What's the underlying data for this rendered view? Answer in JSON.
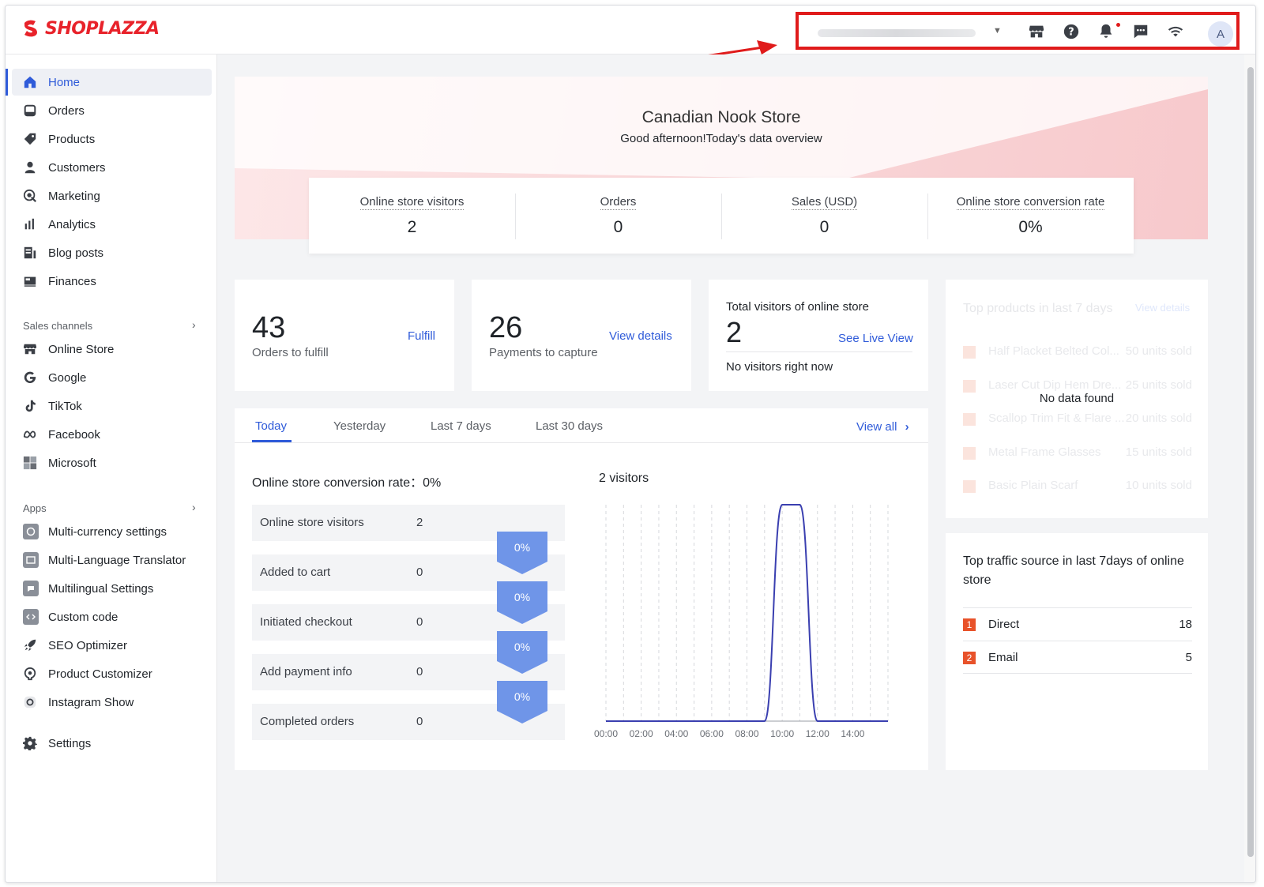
{
  "brand": {
    "name": "SHOPLAZZA",
    "color": "#e8222a"
  },
  "header": {
    "icons": [
      "store-icon",
      "help-icon",
      "bell-icon",
      "message-icon",
      "wifi-icon"
    ],
    "avatar_initial": "A"
  },
  "sidebar": {
    "main_items": [
      {
        "label": "Home",
        "icon": "home-icon",
        "active": true
      },
      {
        "label": "Orders",
        "icon": "orders-icon"
      },
      {
        "label": "Products",
        "icon": "tag-icon"
      },
      {
        "label": "Customers",
        "icon": "person-icon"
      },
      {
        "label": "Marketing",
        "icon": "marketing-icon"
      },
      {
        "label": "Analytics",
        "icon": "bar-chart-icon"
      },
      {
        "label": "Blog posts",
        "icon": "blog-icon"
      },
      {
        "label": "Finances",
        "icon": "finance-icon"
      }
    ],
    "sales_channels_label": "Sales channels",
    "channels": [
      {
        "label": "Online Store",
        "icon": "store-icon"
      },
      {
        "label": "Google",
        "icon": "google-icon"
      },
      {
        "label": "TikTok",
        "icon": "tiktok-icon"
      },
      {
        "label": "Facebook",
        "icon": "meta-icon"
      },
      {
        "label": "Microsoft",
        "icon": "microsoft-icon"
      }
    ],
    "apps_label": "Apps",
    "apps": [
      {
        "label": "Multi-currency settings",
        "icon": "currency-app-icon"
      },
      {
        "label": "Multi-Language Translator",
        "icon": "translator-app-icon"
      },
      {
        "label": "Multilingual Settings",
        "icon": "multilingual-app-icon"
      },
      {
        "label": "Custom code",
        "icon": "code-app-icon"
      },
      {
        "label": "SEO Optimizer",
        "icon": "rocket-icon"
      },
      {
        "label": "Product Customizer",
        "icon": "customizer-app-icon"
      },
      {
        "label": "Instagram Show",
        "icon": "instagram-icon"
      }
    ],
    "settings_label": "Settings"
  },
  "banner": {
    "store_name": "Canadian Nook Store",
    "greeting": "Good afternoon!Today's data overview"
  },
  "kpis": [
    {
      "label": "Online store visitors",
      "value": "2"
    },
    {
      "label": "Orders",
      "value": "0"
    },
    {
      "label": "Sales (USD)",
      "value": "0"
    },
    {
      "label": "Online store conversion rate",
      "value": "0%"
    }
  ],
  "fulfill_card": {
    "count": "43",
    "label": "Orders to fulfill",
    "action": "Fulfill"
  },
  "payments_card": {
    "count": "26",
    "label": "Payments to capture",
    "action": "View details"
  },
  "visitors_card": {
    "title": "Total visitors of online store",
    "count": "2",
    "action": "See Live View",
    "note": "No visitors right now"
  },
  "top_products": {
    "title": "Top products in last 7 days",
    "action": "View details",
    "empty": "No data found",
    "items": [
      {
        "rank": "1",
        "name": "Half Placket Belted Col...",
        "sold": "50 units sold"
      },
      {
        "rank": "2",
        "name": "Laser Cut Dip Hem Dre...",
        "sold": "25 units sold"
      },
      {
        "rank": "3",
        "name": "Scallop Trim Fit & Flare ...",
        "sold": "20 units sold"
      },
      {
        "rank": "4",
        "name": "Metal Frame Glasses",
        "sold": "15 units sold"
      },
      {
        "rank": "5",
        "name": "Basic Plain Scarf",
        "sold": "10 units sold"
      }
    ]
  },
  "overview": {
    "tabs": [
      "Today",
      "Yesterday",
      "Last 7 days",
      "Last 30 days"
    ],
    "active_tab": 0,
    "view_all": "View all",
    "conversion_label": "Online store conversion rate：",
    "conversion_value": "0%",
    "funnel": [
      {
        "label": "Online store visitors",
        "value": "2"
      },
      {
        "label": "Added to cart",
        "value": "0"
      },
      {
        "label": "Initiated checkout",
        "value": "0"
      },
      {
        "label": "Add payment info",
        "value": "0"
      },
      {
        "label": "Completed orders",
        "value": "0"
      }
    ],
    "funnel_rates": [
      "0%",
      "0%",
      "0%",
      "0%"
    ],
    "funnel_color": "#6f95e8"
  },
  "chart_data": {
    "type": "line",
    "title": "2 visitors",
    "x": [
      "00:00",
      "02:00",
      "04:00",
      "06:00",
      "08:00",
      "10:00",
      "12:00",
      "14:00"
    ],
    "series": [
      {
        "x": [
          "00:00",
          "01:00",
          "02:00",
          "03:00",
          "04:00",
          "05:00",
          "06:00",
          "07:00",
          "08:00",
          "09:00",
          "10:00",
          "11:00",
          "12:00",
          "13:00",
          "14:00",
          "15:00",
          "16:00"
        ],
        "values": [
          0,
          0,
          0,
          0,
          0,
          0,
          0,
          0,
          0,
          0,
          2,
          2,
          0,
          0,
          0,
          0,
          0
        ]
      }
    ],
    "ylim": [
      0,
      2
    ],
    "grid": true,
    "line_color": "#3a3fb0"
  },
  "traffic": {
    "title": "Top traffic source in last 7days of online store",
    "rows": [
      {
        "rank": "1",
        "name": "Direct",
        "value": "18"
      },
      {
        "rank": "2",
        "name": "Email",
        "value": "5"
      }
    ]
  }
}
